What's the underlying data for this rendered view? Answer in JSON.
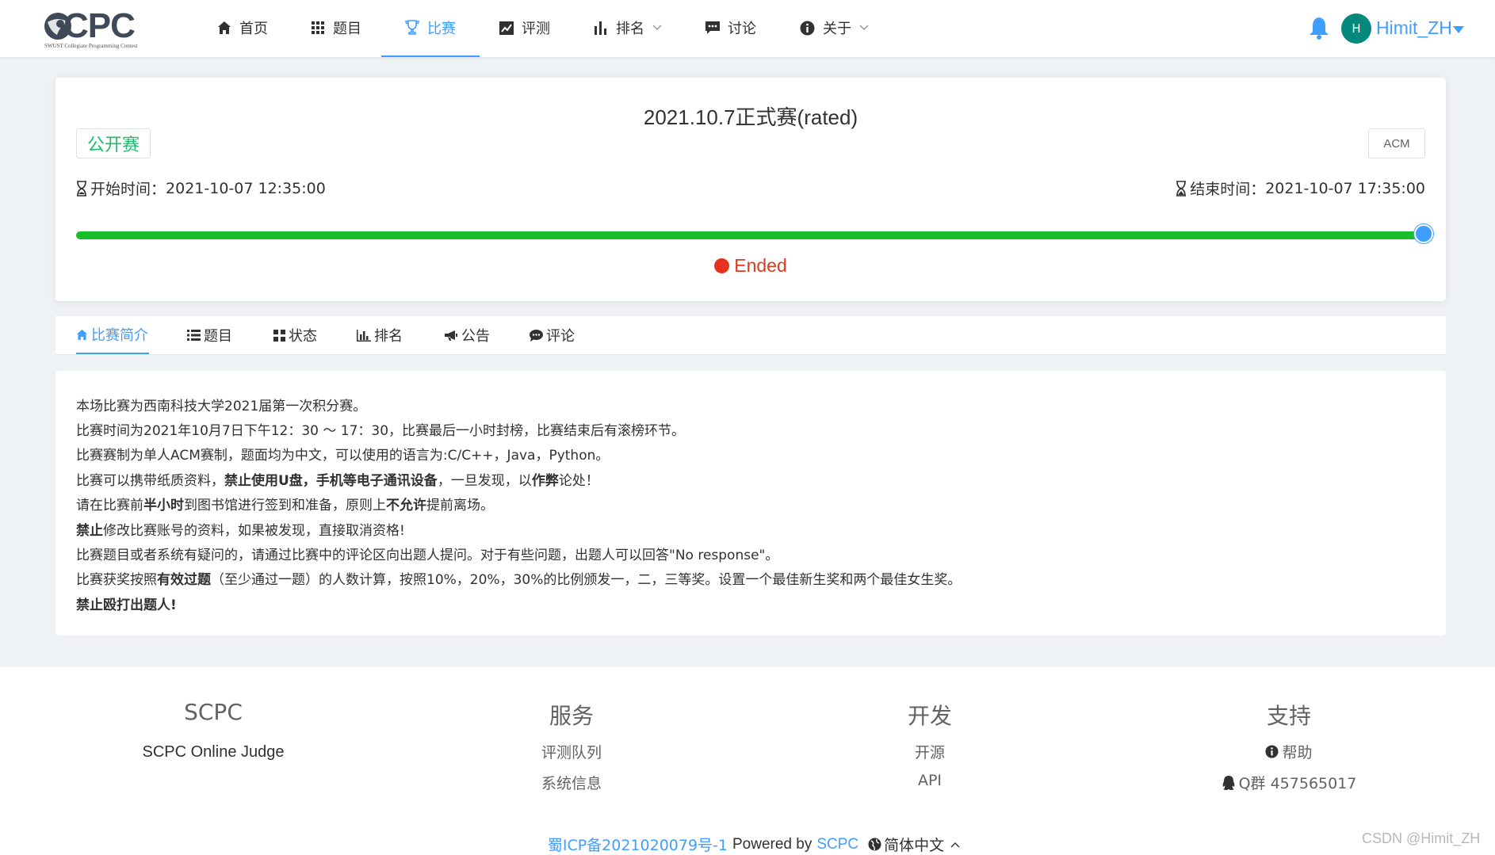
{
  "brand": {
    "logo_text": "CPC",
    "logo_subtitle": "SWUST Collegiate Programming Contest"
  },
  "nav": {
    "items": [
      {
        "label": "首页",
        "icon": "home-icon"
      },
      {
        "label": "题目",
        "icon": "grid-icon"
      },
      {
        "label": "比赛",
        "icon": "trophy-icon",
        "active": true
      },
      {
        "label": "评测",
        "icon": "chart-line-icon"
      },
      {
        "label": "排名",
        "icon": "bar-chart-icon",
        "dropdown": true
      },
      {
        "label": "讨论",
        "icon": "comment-icon"
      },
      {
        "label": "关于",
        "icon": "info-icon",
        "dropdown": true
      }
    ]
  },
  "user": {
    "avatar_letter": "H",
    "name": "Himit_ZH",
    "avatar_color": "#03897b"
  },
  "contest": {
    "title": "2021.10.7正式赛(rated)",
    "type_tag": "公开赛",
    "format_tag": "ACM",
    "start_label": "开始时间：",
    "start_time": "2021-10-07 12:35:00",
    "end_label": "结束时间：",
    "end_time": "2021-10-07 17:35:00",
    "progress_percent": 100,
    "status": "Ended",
    "colors": {
      "progress": "#19be2b",
      "status": "#e03a1e",
      "accent": "#409eff"
    }
  },
  "tabs": [
    {
      "label": "比赛简介",
      "icon": "home-icon",
      "active": true
    },
    {
      "label": "题目",
      "icon": "list-icon"
    },
    {
      "label": "状态",
      "icon": "grid-icon"
    },
    {
      "label": "排名",
      "icon": "bar-chart-icon"
    },
    {
      "label": "公告",
      "icon": "bullhorn-icon"
    },
    {
      "label": "评论",
      "icon": "comment-icon"
    }
  ],
  "description": {
    "l1": "本场比赛为西南科技大学2021届第一次积分赛。",
    "l2": "比赛时间为2021年10月7日下午12：30 ～ 17：30，比赛最后一小时封榜，比赛结束后有滚榜环节。",
    "l3": "比赛赛制为单人ACM赛制，题面均为中文，可以使用的语言为:C/C++，Java，Python。",
    "l4": {
      "a": "比赛可以携带纸质资料，",
      "b": "禁止使用U盘，手机等电子通讯设备",
      "c": "，一旦发现，以",
      "d": "作弊",
      "e": "论处！"
    },
    "l5": {
      "a": "请在比赛前",
      "b": "半小时",
      "c": "到图书馆进行签到和准备，原则上",
      "d": "不允许",
      "e": "提前离场。"
    },
    "l6": {
      "a": "禁止",
      "b": "修改比赛账号的资料，如果被发现，直接取消资格!"
    },
    "l7": "比赛题目或者系统有疑问的，请通过比赛中的评论区向出题人提问。对于有些问题，出题人可以回答\"No response\"。",
    "l8": {
      "a": "比赛获奖按照",
      "b": "有效过题",
      "c": "（至少通过一题）的人数计算，按照10%，20%，30%的比例颁发一，二，三等奖。设置一个最佳新生奖和两个最佳女生奖。"
    },
    "l9": "禁止殴打出题人!"
  },
  "footer": {
    "columns": [
      {
        "heading": "SCPC",
        "links": [
          "SCPC Online Judge"
        ]
      },
      {
        "heading": "服务",
        "links": [
          "评测队列",
          "系统信息"
        ]
      },
      {
        "heading": "开发",
        "links": [
          "开源",
          "API"
        ]
      },
      {
        "heading": "支持",
        "links": [
          "帮助",
          "Q群 457565017"
        ]
      }
    ],
    "icp": "蜀ICP备2021020079号-1",
    "powered_by": "Powered by",
    "powered_link": "SCPC",
    "language": "简体中文"
  },
  "watermark": "CSDN @Himit_ZH"
}
